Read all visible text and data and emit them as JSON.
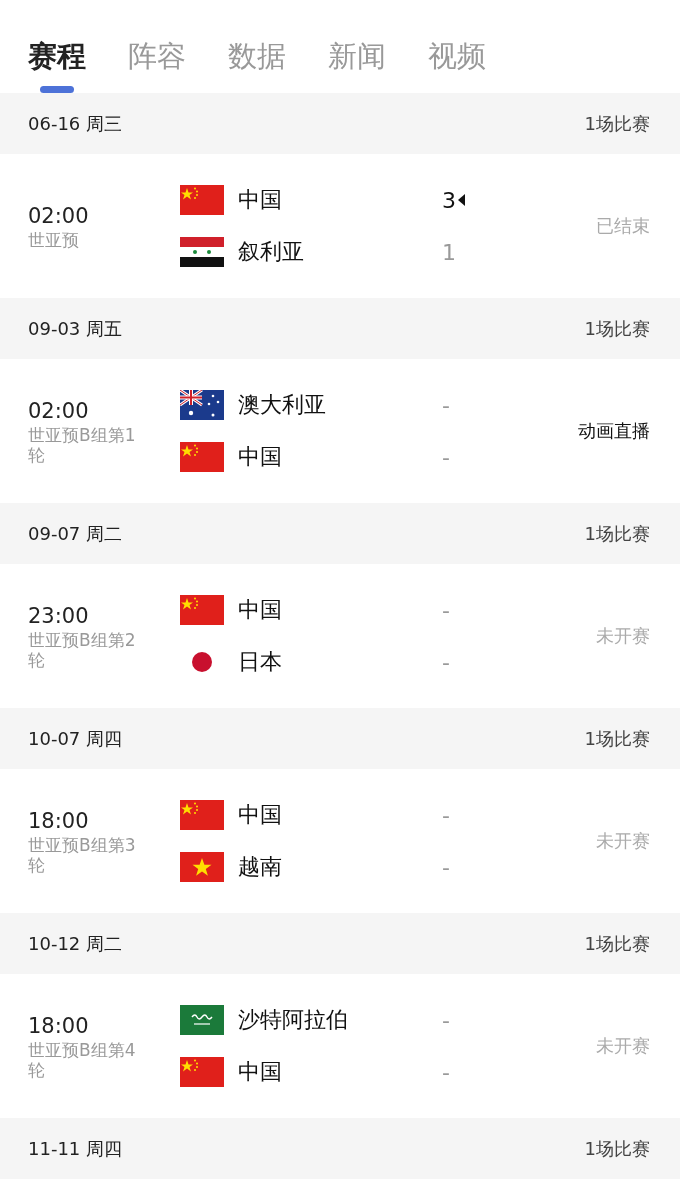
{
  "tabs": [
    {
      "label": "赛程",
      "selected": true
    },
    {
      "label": "阵容",
      "selected": false
    },
    {
      "label": "数据",
      "selected": false
    },
    {
      "label": "新闻",
      "selected": false
    },
    {
      "label": "视频",
      "selected": false
    }
  ],
  "days": [
    {
      "date": "06-16 周三",
      "count": "1场比赛",
      "matches": [
        {
          "time": "02:00",
          "competition": "世亚预",
          "teams": [
            {
              "kind": "china",
              "name": "中国",
              "score": "3",
              "winner": true
            },
            {
              "kind": "syria",
              "name": "叙利亚",
              "score": "1",
              "winner": false
            }
          ],
          "status": "已结束",
          "highlighted": false
        }
      ]
    },
    {
      "date": "09-03 周五",
      "count": "1场比赛",
      "matches": [
        {
          "time": "02:00",
          "competition": "世亚预B组第1轮",
          "teams": [
            {
              "kind": "australia",
              "name": "澳大利亚",
              "score": "-",
              "winner": false
            },
            {
              "kind": "china",
              "name": "中国",
              "score": "-",
              "winner": false
            }
          ],
          "status": "动画直播",
          "highlighted": true
        }
      ]
    },
    {
      "date": "09-07 周二",
      "count": "1场比赛",
      "matches": [
        {
          "time": "23:00",
          "competition": "世亚预B组第2轮",
          "teams": [
            {
              "kind": "china",
              "name": "中国",
              "score": "-",
              "winner": false
            },
            {
              "kind": "japan",
              "name": "日本",
              "score": "-",
              "winner": false
            }
          ],
          "status": "未开赛",
          "highlighted": false
        }
      ]
    },
    {
      "date": "10-07 周四",
      "count": "1场比赛",
      "matches": [
        {
          "time": "18:00",
          "competition": "世亚预B组第3轮",
          "teams": [
            {
              "kind": "china",
              "name": "中国",
              "score": "-",
              "winner": false
            },
            {
              "kind": "vietnam",
              "name": "越南",
              "score": "-",
              "winner": false
            }
          ],
          "status": "未开赛",
          "highlighted": false
        }
      ]
    },
    {
      "date": "10-12 周二",
      "count": "1场比赛",
      "matches": [
        {
          "time": "18:00",
          "competition": "世亚预B组第4轮",
          "teams": [
            {
              "kind": "saudi",
              "name": "沙特阿拉伯",
              "score": "-",
              "winner": false
            },
            {
              "kind": "china",
              "name": "中国",
              "score": "-",
              "winner": false
            }
          ],
          "status": "未开赛",
          "highlighted": false
        }
      ]
    },
    {
      "date": "11-11 周四",
      "count": "1场比赛"
    }
  ]
}
